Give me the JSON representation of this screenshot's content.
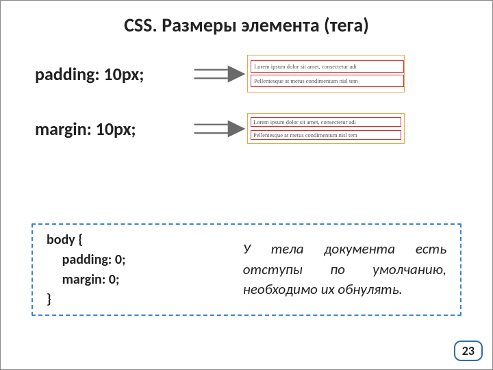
{
  "title": "CSS. Размеры элемента (тега)",
  "rows": [
    {
      "label": "padding: 10px;",
      "kind": "padding"
    },
    {
      "label": "margin: 10px;",
      "kind": "margin"
    }
  ],
  "example_lines": [
    "Lorem ipsum dolor sit amet, consectetur adi",
    "Pellentesque at metus condimentum nisl tem"
  ],
  "code": "body {\n     padding: 0;\n     margin: 0;\n}",
  "note": "У тела документа есть отступы по умолчанию, необходимо их обнулять.",
  "page": "23",
  "arrow_color": "#6a6a6a"
}
